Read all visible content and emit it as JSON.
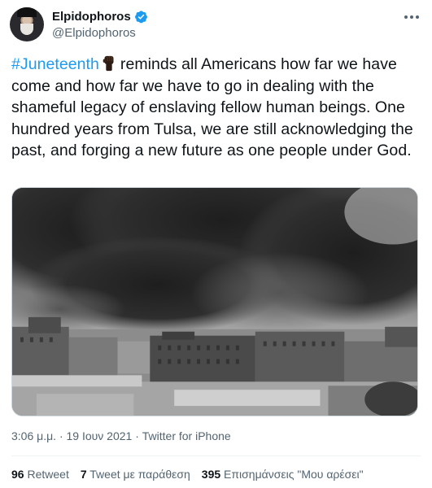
{
  "author": {
    "display_name": "Elpidophoros",
    "handle": "@Elpidophoros",
    "verified_icon": "verified-badge-icon",
    "avatar_icon": "avatar"
  },
  "tweet": {
    "hashtag": "#Juneteenth",
    "emoji_icon": "raised-fist-icon",
    "body": "reminds all Americans how far we have come and how far we have to go in dealing with the shameful legacy of enslaving fellow human beings. One hundred years from Tulsa, we are still acknowledging the past, and forging a new future as one people under God."
  },
  "metadata": {
    "time_date": "3:06 μ.μ. · 19 Ιουν 2021 · ",
    "source": "Twitter for iPhone"
  },
  "stats": {
    "retweets_count": "96",
    "retweets_label": "Retweet",
    "quotes_count": "7",
    "quotes_label": "Tweet με παράθεση",
    "likes_count": "395",
    "likes_label": "Επισημάνσεις \"Μου αρέσει\""
  },
  "colors": {
    "hashtag": "#1d9bf0",
    "verified": "#1d9bf0",
    "secondary_text": "#536471",
    "primary_text": "#0f1419"
  }
}
